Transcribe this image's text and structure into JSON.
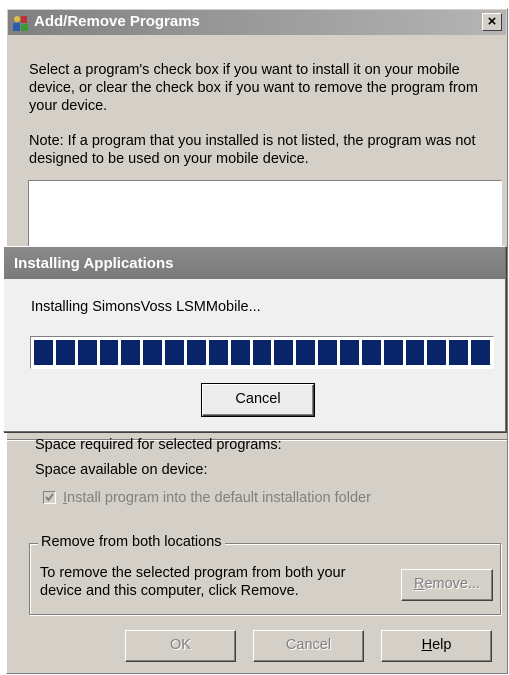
{
  "window": {
    "title": "Add/Remove Programs",
    "close_label": "×"
  },
  "main": {
    "instruction": "Select a program's check box if you want to install it on your mobile device, or clear the check box if you want to remove the program from your device.",
    "note": "Note:  If a program that you installed is not listed, the program was not designed to be used on your mobile device.",
    "space_required_label": "Space required for selected programs:",
    "space_available_label": "Space available on device:",
    "default_folder_checkbox": {
      "label_prefix": "I",
      "label_rest": "nstall program into the default installation folder",
      "checked": true,
      "enabled": false
    },
    "remove_group": {
      "legend": "Remove from both locations",
      "text": "To remove the selected program from both your device and this computer, click Remove.",
      "remove_label_prefix": "R",
      "remove_label_rest": "emove..."
    }
  },
  "footer": {
    "ok_label": "OK",
    "cancel_label": "Cancel",
    "help_label_prefix": "H",
    "help_label_rest": "elp"
  },
  "progress_dialog": {
    "title": "Installing Applications",
    "message": "Installing SimonsVoss LSMMobile...",
    "progress_fraction": 1.0,
    "segments": 21,
    "cancel_label": "Cancel",
    "bar_color": "#0a246a"
  }
}
